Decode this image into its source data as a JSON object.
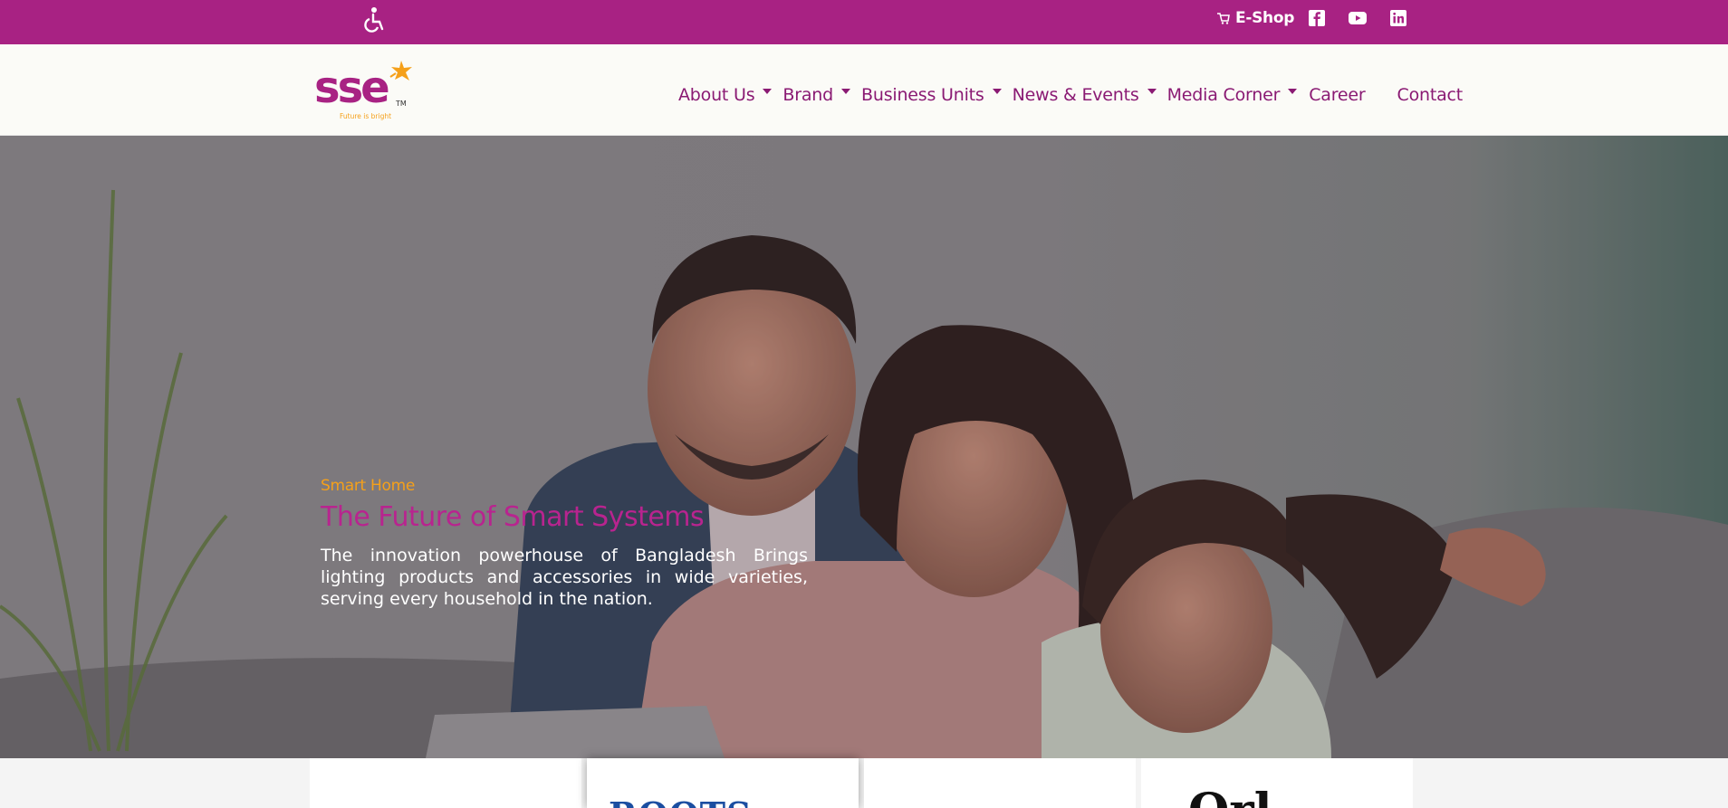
{
  "topbar": {
    "accessibility_icon": "wheelchair-icon",
    "eshop_label": "E-Shop",
    "eshop_icon": "cart-icon",
    "social": [
      "facebook-icon",
      "youtube-icon",
      "linkedin-icon"
    ]
  },
  "header": {
    "logo_text": "sse",
    "logo_tagline": "Future is bright",
    "logo_tm": "TM",
    "nav": [
      {
        "label": "About Us",
        "has_dropdown": true
      },
      {
        "label": "Brand",
        "has_dropdown": true
      },
      {
        "label": "Business Units",
        "has_dropdown": true
      },
      {
        "label": "News & Events",
        "has_dropdown": true
      },
      {
        "label": "Media Corner",
        "has_dropdown": true
      },
      {
        "label": "Career",
        "has_dropdown": false
      },
      {
        "label": "Contact",
        "has_dropdown": false
      }
    ]
  },
  "hero": {
    "eyebrow": "Smart Home",
    "title": "The Future of Smart Systems",
    "description": "The innovation powerhouse of Bangladesh Brings lighting products and accessories in wide varieties, serving every household in the nation."
  },
  "cards": [
    {
      "logo_fragment": ""
    },
    {
      "logo_fragment": "ROOTS"
    },
    {
      "logo_fragment": ""
    },
    {
      "logo_fragment": "Orl"
    }
  ],
  "colors": {
    "brand_magenta": "#a82283",
    "nav_text": "#8a1a73",
    "accent_orange": "#f5a01a"
  }
}
